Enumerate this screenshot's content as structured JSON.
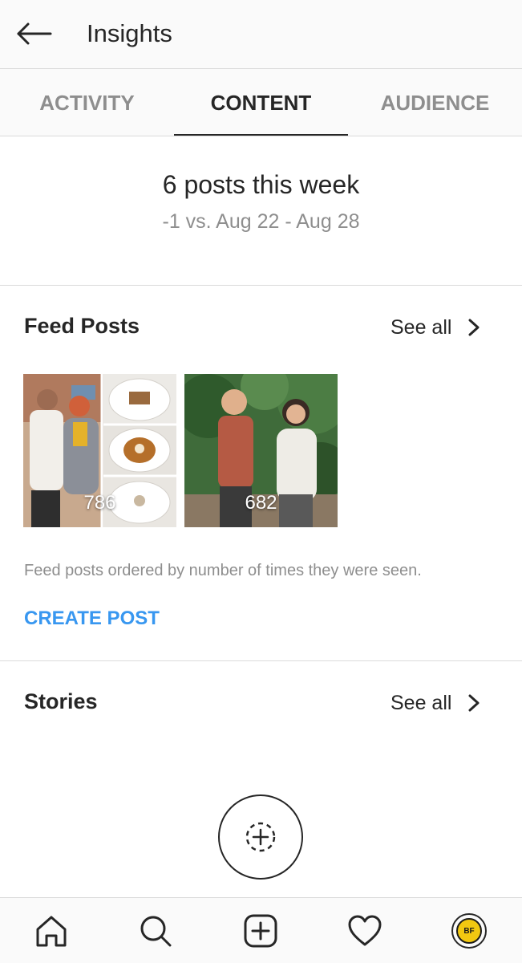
{
  "header": {
    "title": "Insights",
    "back_icon": "arrow-left-icon"
  },
  "tabs": [
    {
      "label": "ACTIVITY",
      "active": false
    },
    {
      "label": "CONTENT",
      "active": true
    },
    {
      "label": "AUDIENCE",
      "active": false
    }
  ],
  "summary": {
    "title": "6 posts this week",
    "comparison": "-1 vs. Aug 22 - Aug 28"
  },
  "feed_posts": {
    "title": "Feed Posts",
    "see_all_label": "See all",
    "posts": [
      {
        "count": "786"
      },
      {
        "count": "682"
      }
    ],
    "note": "Feed posts ordered by number of times they were seen.",
    "create_label": "CREATE POST"
  },
  "stories": {
    "title": "Stories",
    "see_all_label": "See all",
    "add_icon": "add-story-icon"
  },
  "bottom_nav": {
    "items": [
      "home-icon",
      "search-icon",
      "new-post-icon",
      "heart-icon",
      "profile-avatar"
    ],
    "avatar_text": "BF"
  },
  "colors": {
    "accent": "#3897f0",
    "text": "#262626",
    "muted": "#8e8e8e",
    "divider": "#dbdbdb"
  }
}
